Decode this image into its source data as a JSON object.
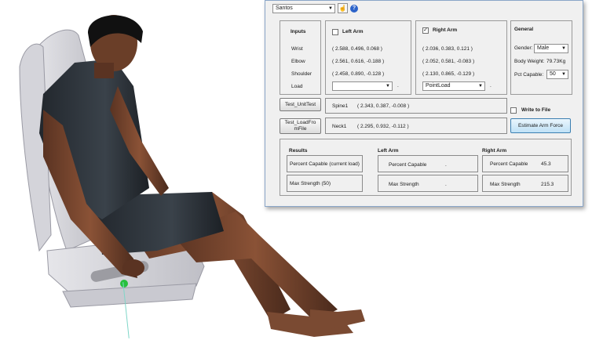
{
  "toolbar": {
    "model_select": "Santos",
    "pointer_icon": "hand-pointer-icon",
    "help_icon": "help-icon"
  },
  "inputs": {
    "header": "Inputs",
    "rows": [
      "Wrist",
      "Elbow",
      "Shoulder",
      "Load"
    ]
  },
  "left_arm": {
    "label": "Left Arm",
    "checked": false,
    "wrist": "( 2.588, 0.496, 0.068 )",
    "elbow": "( 2.561, 0.616, -0.188 )",
    "shoulder": "( 2.458, 0.890, -0.128 )",
    "load_select": "",
    "load_suffix": "."
  },
  "right_arm": {
    "label": "Right Arm",
    "checked": true,
    "wrist": "( 2.036, 0.383, 0.121 )",
    "elbow": "( 2.052, 0.581, -0.083 )",
    "shoulder": "( 2.130, 0.865, -0.129 )",
    "load_select": "PointLoad",
    "load_suffix": "."
  },
  "general": {
    "header": "General",
    "gender_label": "Gender:",
    "gender_value": "Male",
    "body_weight_label": "Body Weight:",
    "body_weight_value": "79.73Kg",
    "pct_capable_label": "Pct Capable:",
    "pct_capable_value": "50"
  },
  "actions": {
    "unit_test": "Test_UnitTest",
    "load_from_file_line1": "Test_LoadFro",
    "load_from_file_line2": "mFile",
    "write_to_file": "Write to File",
    "estimate": "Estimate Arm Force"
  },
  "joints": {
    "spine_label": "Spine1",
    "spine_value": "( 2.343, 0.387, -0.008 )",
    "neck_label": "Neck1",
    "neck_value": "( 2.295, 0.932, -0.112 )"
  },
  "results": {
    "header": "Results",
    "left_header": "Left Arm",
    "right_header": "Right Arm",
    "row1_label": "Percent Capable (current load)",
    "row2_label": "Max Strength (50)",
    "left_pc_label": "Percent Capable",
    "left_pc_value": ".",
    "left_ms_label": "Max Strength",
    "left_ms_value": ".",
    "right_pc_label": "Percent Capable",
    "right_pc_value": "45.3",
    "right_ms_label": "Max Strength",
    "right_ms_value": "215.3"
  }
}
